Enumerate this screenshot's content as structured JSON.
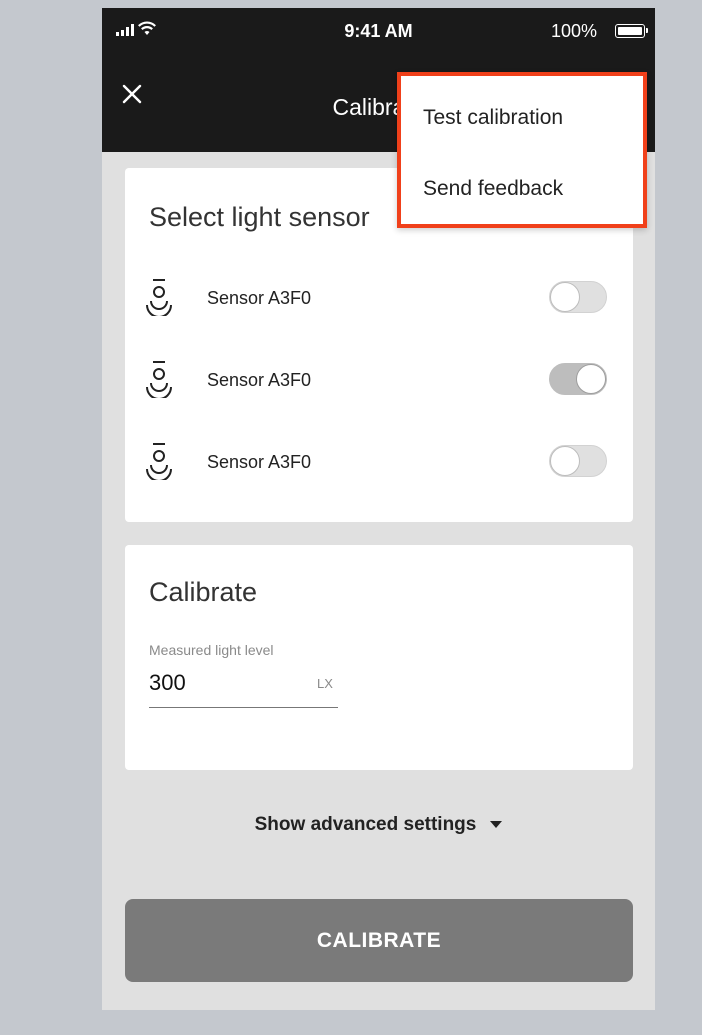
{
  "status_bar": {
    "time": "9:41 AM",
    "battery": "100%"
  },
  "app_bar": {
    "title": "Calibrate",
    "close_icon": "close-icon"
  },
  "sensors_card": {
    "title": "Select light sensor",
    "sensors": [
      {
        "label": "Sensor A3F0",
        "icon": "light-sensor-icon",
        "enabled": false
      },
      {
        "label": "Sensor A3F0",
        "icon": "light-sensor-icon",
        "enabled": true
      },
      {
        "label": "Sensor A3F0",
        "icon": "light-sensor-icon",
        "enabled": false
      }
    ]
  },
  "calibrate_card": {
    "title": "Calibrate",
    "field_label": "Measured light level",
    "value": "300",
    "unit": "LX"
  },
  "advanced_toggle": "Show advanced settings",
  "calibrate_button": "CALIBRATE",
  "overflow_menu": {
    "highlight_color": "#f0401a",
    "items": [
      "Test calibration",
      "Send feedback"
    ]
  },
  "colors": {
    "app_bar": "#1a1a1a",
    "background": "#e0e0e0",
    "button": "#7a7a7a"
  }
}
